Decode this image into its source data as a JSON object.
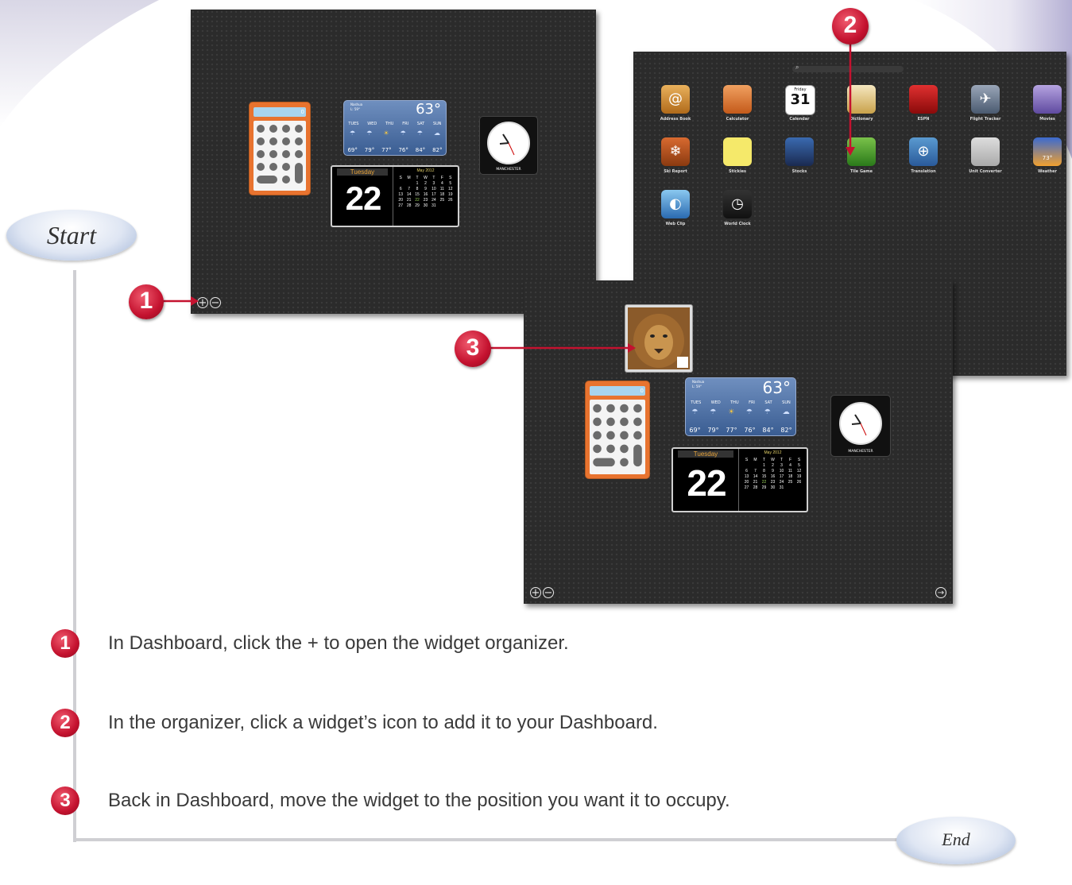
{
  "dashboard1": {
    "weather": {
      "city": "Nashua",
      "lo": "L: 59°",
      "temp": "63°",
      "days": [
        "TUES",
        "WED",
        "THU",
        "FRI",
        "SAT",
        "SUN"
      ],
      "temps": [
        "69°",
        "79°",
        "77°",
        "76°",
        "84°",
        "82°"
      ]
    },
    "calendar": {
      "day_name": "Tuesday",
      "day_num": "22",
      "month": "May 2012"
    },
    "clock_city": "MANCHESTER",
    "calc_display": "0"
  },
  "organizer": {
    "widgets": [
      {
        "label": "Address Book"
      },
      {
        "label": "Calculator"
      },
      {
        "label": "Calendar",
        "num": "31",
        "day": "Friday"
      },
      {
        "label": "Dictionary"
      },
      {
        "label": "ESPN"
      },
      {
        "label": "Flight Tracker"
      },
      {
        "label": "Movies"
      },
      {
        "label": "Ski Report"
      },
      {
        "label": "Stickies"
      },
      {
        "label": "Stocks"
      },
      {
        "label": "Tile Game"
      },
      {
        "label": "Translation"
      },
      {
        "label": "Unit Converter"
      },
      {
        "label": "Weather",
        "temp": "73°"
      },
      {
        "label": "Web Clip"
      },
      {
        "label": "World Clock"
      }
    ]
  },
  "dashboard3": {
    "weather": {
      "city": "Nashua",
      "lo": "L: 59°",
      "temp": "63°",
      "days": [
        "TUES",
        "WED",
        "THU",
        "FRI",
        "SAT",
        "SUN"
      ],
      "temps": [
        "69°",
        "79°",
        "77°",
        "76°",
        "84°",
        "82°"
      ]
    },
    "calendar": {
      "day_name": "Tuesday",
      "day_num": "22",
      "month": "May 2012"
    },
    "clock_city": "MANCHESTER",
    "calc_display": "0"
  },
  "calendar_grid": [
    "S",
    "M",
    "T",
    "W",
    "T",
    "F",
    "S",
    "",
    "",
    "1",
    "2",
    "3",
    "4",
    "5",
    "6",
    "7",
    "8",
    "9",
    "10",
    "11",
    "12",
    "13",
    "14",
    "15",
    "16",
    "17",
    "18",
    "19",
    "20",
    "21",
    "22",
    "23",
    "24",
    "25",
    "26",
    "27",
    "28",
    "29",
    "30",
    "31",
    "",
    ""
  ],
  "labels": {
    "start": "Start",
    "end": "End"
  },
  "callouts": {
    "one": "1",
    "two": "2",
    "three": "3"
  },
  "steps": [
    {
      "num": "1",
      "text": "In Dashboard, click the + to open the widget organizer."
    },
    {
      "num": "2",
      "text": "In the organizer, click a widget’s icon to add it to your Dashboard."
    },
    {
      "num": "3",
      "text": "Back in Dashboard, move the widget to the position you want it to occupy."
    }
  ],
  "colors": {
    "callout_red": "#c4122f",
    "line": "#c8c8cc",
    "accent_lavender": "#b9b4d8"
  }
}
